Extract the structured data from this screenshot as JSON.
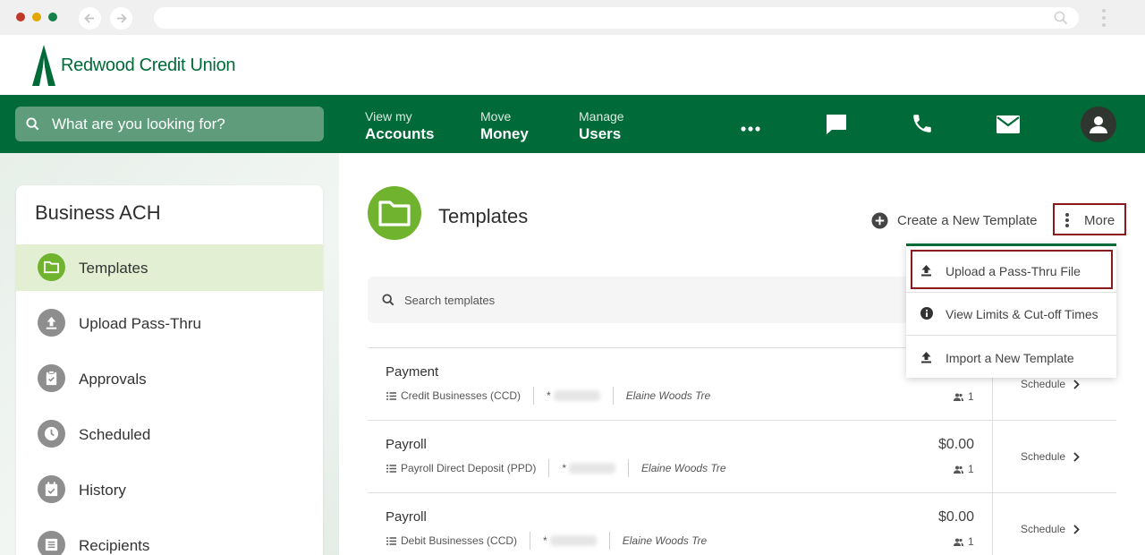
{
  "brand": {
    "name": "Redwood Credit Union",
    "color": "#006b38",
    "accent": "#6fb32e"
  },
  "search": {
    "placeholder": "What are you looking for?"
  },
  "nav": [
    {
      "small": "View my",
      "big": "Accounts"
    },
    {
      "small": "Move",
      "big": "Money"
    },
    {
      "small": "Manage",
      "big": "Users"
    }
  ],
  "nav_icons": [
    "more-horizontal-icon",
    "chat-icon",
    "phone-icon",
    "mail-icon",
    "user-avatar-icon"
  ],
  "sidebar": {
    "title": "Business ACH",
    "items": [
      {
        "label": "Templates",
        "icon": "folder-icon",
        "active": true
      },
      {
        "label": "Upload Pass-Thru",
        "icon": "upload-icon"
      },
      {
        "label": "Approvals",
        "icon": "clipboard-check-icon"
      },
      {
        "label": "Scheduled",
        "icon": "clock-icon"
      },
      {
        "label": "History",
        "icon": "calendar-check-icon"
      },
      {
        "label": "Recipients",
        "icon": "list-icon"
      }
    ]
  },
  "main": {
    "title": "Templates",
    "create_label": "Create a New Template",
    "more_label": "More",
    "search_placeholder": "Search templates"
  },
  "dropdown": {
    "items": [
      {
        "label": "Upload a Pass-Thru File",
        "icon": "upload-icon"
      },
      {
        "label": "View Limits & Cut-off Times",
        "icon": "info-icon"
      },
      {
        "label": "Import a New Template",
        "icon": "upload-icon"
      }
    ]
  },
  "templates": [
    {
      "name": "Payment",
      "type": "Credit Businesses (CCD)",
      "account_prefix": "*",
      "owner": "Elaine Woods Tre",
      "amount": "",
      "users": "1",
      "action": "Schedule"
    },
    {
      "name": "Payroll",
      "type": "Payroll Direct Deposit (PPD)",
      "account_prefix": "*",
      "owner": "Elaine Woods Tre",
      "amount": "$0.00",
      "users": "1",
      "action": "Schedule"
    },
    {
      "name": "Payroll",
      "type": "Debit Businesses (CCD)",
      "account_prefix": "*",
      "owner": "Elaine Woods Tre",
      "amount": "$0.00",
      "users": "1",
      "action": "Schedule"
    }
  ]
}
